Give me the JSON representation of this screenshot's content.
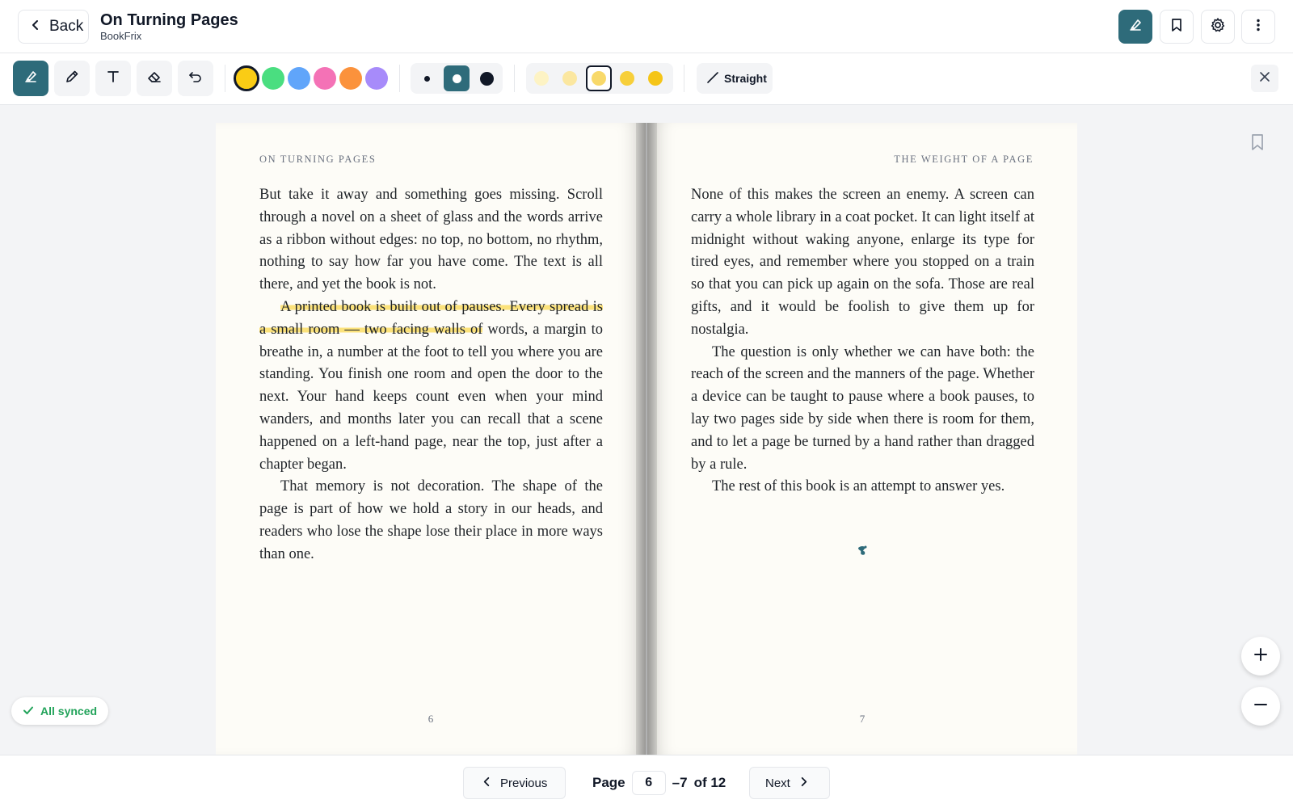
{
  "header": {
    "back_label": "Back",
    "title": "On Turning Pages",
    "subtitle": "BookFrix"
  },
  "toolbar": {
    "straight_label": "Straight",
    "colors": [
      "#facc15",
      "#4ade80",
      "#60a5fa",
      "#f472b6",
      "#fb923c",
      "#a78bfa"
    ],
    "selected_color": "#facc15",
    "selected_size": "medium",
    "highlight_opacities": [
      "#fdf3c4",
      "#fbe7a0",
      "#f8d96a",
      "#f7cf3a",
      "#f5c518"
    ],
    "selected_opacity_index": 2
  },
  "left_page": {
    "running_head": "ON TURNING PAGES",
    "p1": "But take it away and something goes missing. Scroll through a novel on a sheet of glass and the words arrive as a ribbon without edges: no top, no bottom, no rhythm, nothing to say how far you have come. The text is all there, and yet the book is not.",
    "p2_highlight": "A printed book is built out of pauses. Every spread is a small room — two facing walls of",
    "p2_rest": " words, a margin to breathe in, a number at the foot to tell you where you are standing. You finish one room and open the door to the next. Your hand keeps count even when your mind wanders, and months later you can recall that a scene happened on a left-hand page, near the top, just after a chapter began.",
    "p3": "That memory is not decoration. The shape of the page is part of how we hold a story in our heads, and readers who lose the shape lose their place in more ways than one.",
    "folio": "6"
  },
  "right_page": {
    "running_head": "THE WEIGHT OF A PAGE",
    "p1": "None of this makes the screen an enemy. A screen can carry a whole library in a coat pocket. It can light itself at midnight without waking anyone, enlarge its type for tired eyes, and remember where you stopped on a train so that you can pick up again on the sofa. Those are real gifts, and it would be foolish to give them up for nostalgia.",
    "p2": "The question is only whether we can have both: the reach of the screen and the manners of the page. Whether a device can be taught to pause where a book pauses, to lay two pages side by side when there is room for them, and to let a page be turned by a hand rather than dragged by a rule.",
    "p3": "The rest of this book is an attempt to answer yes.",
    "folio": "7"
  },
  "status": {
    "sync_label": "All synced"
  },
  "footer": {
    "previous_label": "Previous",
    "next_label": "Next",
    "page_label": "Page",
    "current_page": "6",
    "page_range_suffix": "–7",
    "of_label": "of 12"
  },
  "icons": {
    "back": "chevron-left-icon",
    "highlighter": "highlighter-icon",
    "bookmark": "bookmark-icon",
    "settings": "gear-icon",
    "more": "more-vertical-icon",
    "pencil": "pencil-icon",
    "text": "text-icon",
    "eraser": "eraser-icon",
    "undo": "undo-icon",
    "close": "close-icon",
    "sync": "check-icon",
    "zoom_in": "plus-icon",
    "zoom_out": "minus-icon"
  }
}
